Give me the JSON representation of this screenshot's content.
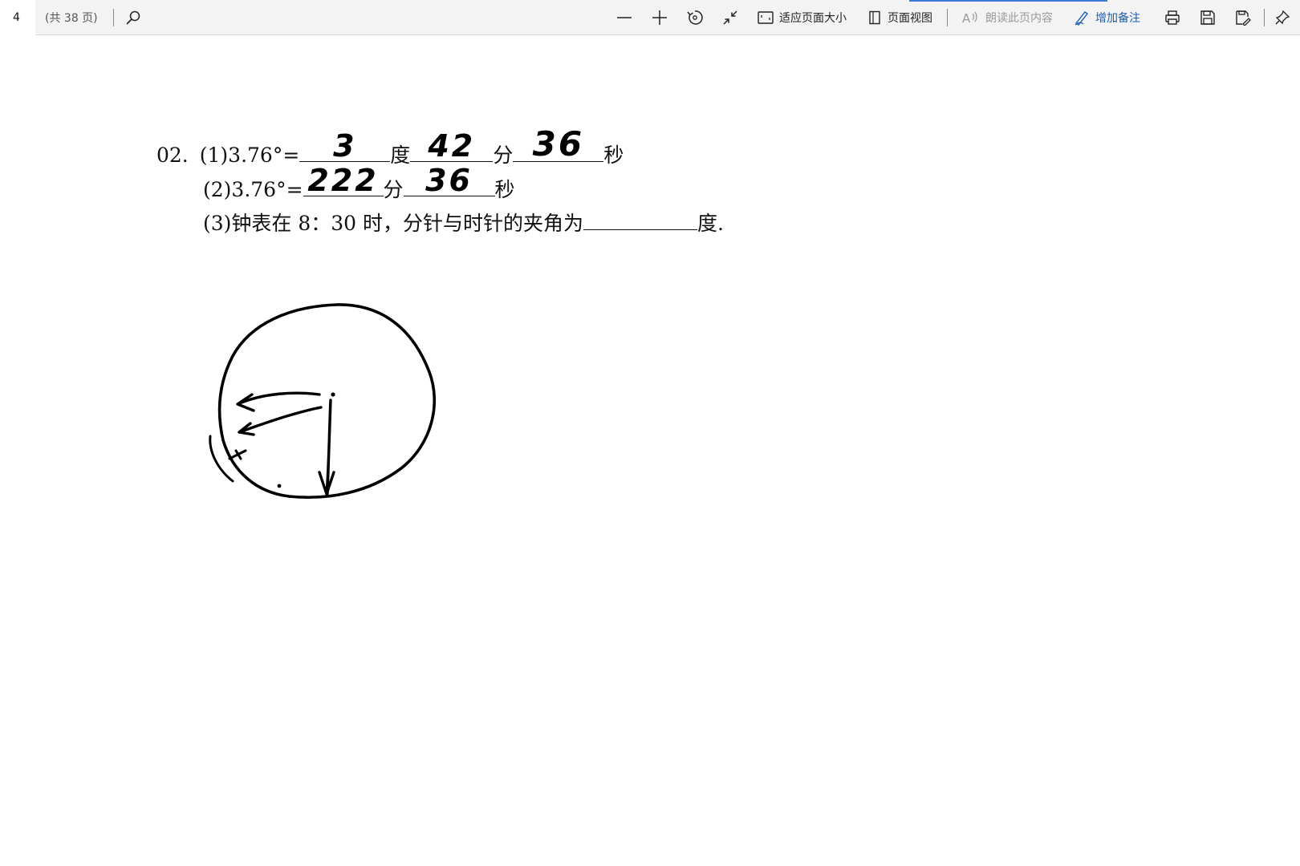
{
  "toolbar": {
    "page_number": "4",
    "page_total": "(共 38 页)",
    "fit_page_label": "适应页面大小",
    "page_view_label": "页面视图",
    "read_aloud_label": "朗读此页内容",
    "add_note_label": "增加备注",
    "icons": [
      "search-icon",
      "zoom-out-icon",
      "zoom-in-icon",
      "rotate-icon",
      "collapse-icon",
      "fit-page-icon",
      "page-view-icon",
      "read-aloud-icon",
      "add-note-icon",
      "print-icon",
      "save-icon",
      "save-as-icon",
      "pin-icon"
    ],
    "accent_color": "#1a5fb4"
  },
  "question": {
    "number": "02.",
    "part1": {
      "prefix": "(1)3.76°=",
      "answer_degrees": "3",
      "unit_degrees": "度",
      "answer_minutes": "42",
      "unit_minutes": "分",
      "answer_seconds": "36",
      "unit_seconds": "秒"
    },
    "part2": {
      "prefix": "(2)3.76°=",
      "answer_minutes": "222",
      "unit_minutes": "分",
      "answer_seconds": "36",
      "unit_seconds": "秒"
    },
    "part3": {
      "prefix": "(3)钟表在 8：30 时，分针与时针的夹角为",
      "answer": "",
      "suffix": "度."
    }
  }
}
